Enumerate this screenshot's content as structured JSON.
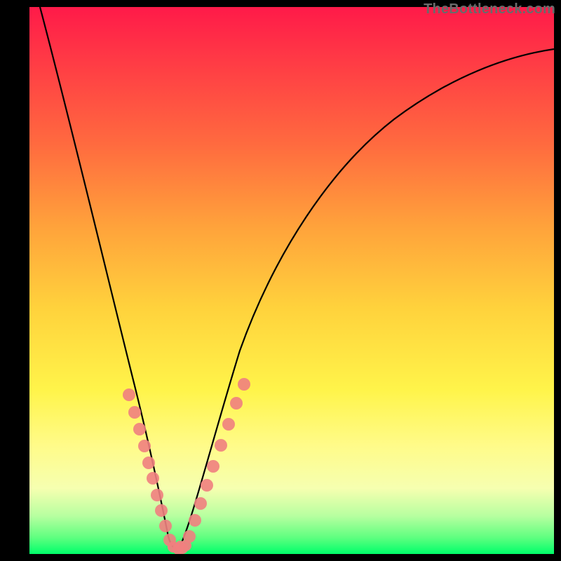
{
  "watermark": "TheBottleneck.com",
  "chart_data": {
    "type": "line",
    "title": "",
    "xlabel": "",
    "ylabel": "",
    "xlim": [
      0,
      100
    ],
    "ylim": [
      0,
      100
    ],
    "grid": false,
    "legend": null,
    "series": [
      {
        "name": "bottleneck-curve",
        "x": [
          2,
          5,
          10,
          15,
          18,
          20,
          22,
          24,
          25,
          26,
          28,
          30,
          35,
          40,
          45,
          50,
          55,
          60,
          70,
          80,
          90,
          100
        ],
        "y": [
          100,
          85,
          60,
          38,
          27,
          20,
          12,
          5,
          2,
          1,
          1,
          3,
          14,
          25,
          36,
          45,
          53,
          60,
          70,
          77,
          82,
          86
        ]
      }
    ],
    "markers": [
      {
        "name": "data-points-left",
        "x": [
          17.5,
          18.5,
          19.5,
          20.5,
          21.5,
          22.0,
          23.0,
          23.5,
          24.5,
          25.0
        ],
        "y": [
          29,
          26,
          23,
          20,
          16,
          13,
          9,
          6,
          3,
          1
        ],
        "color": "#f08080"
      },
      {
        "name": "data-points-right",
        "x": [
          27.0,
          28.0,
          29.0,
          30.0,
          31.0,
          32.0,
          33.0,
          34.0,
          35.0
        ],
        "y": [
          1,
          3,
          6,
          9,
          13,
          18,
          23,
          28,
          33
        ],
        "color": "#f08080"
      },
      {
        "name": "valley-points",
        "x": [
          25.0,
          25.5,
          26.0,
          26.5,
          27.0
        ],
        "y": [
          0.5,
          0.3,
          0.3,
          0.4,
          0.6
        ],
        "color": "#f08080"
      }
    ],
    "colors": {
      "curve": "#000000",
      "marker": "#f08080",
      "gradient_top": "#ff1a49",
      "gradient_bottom": "#00ff6a",
      "background": "#000000"
    }
  }
}
